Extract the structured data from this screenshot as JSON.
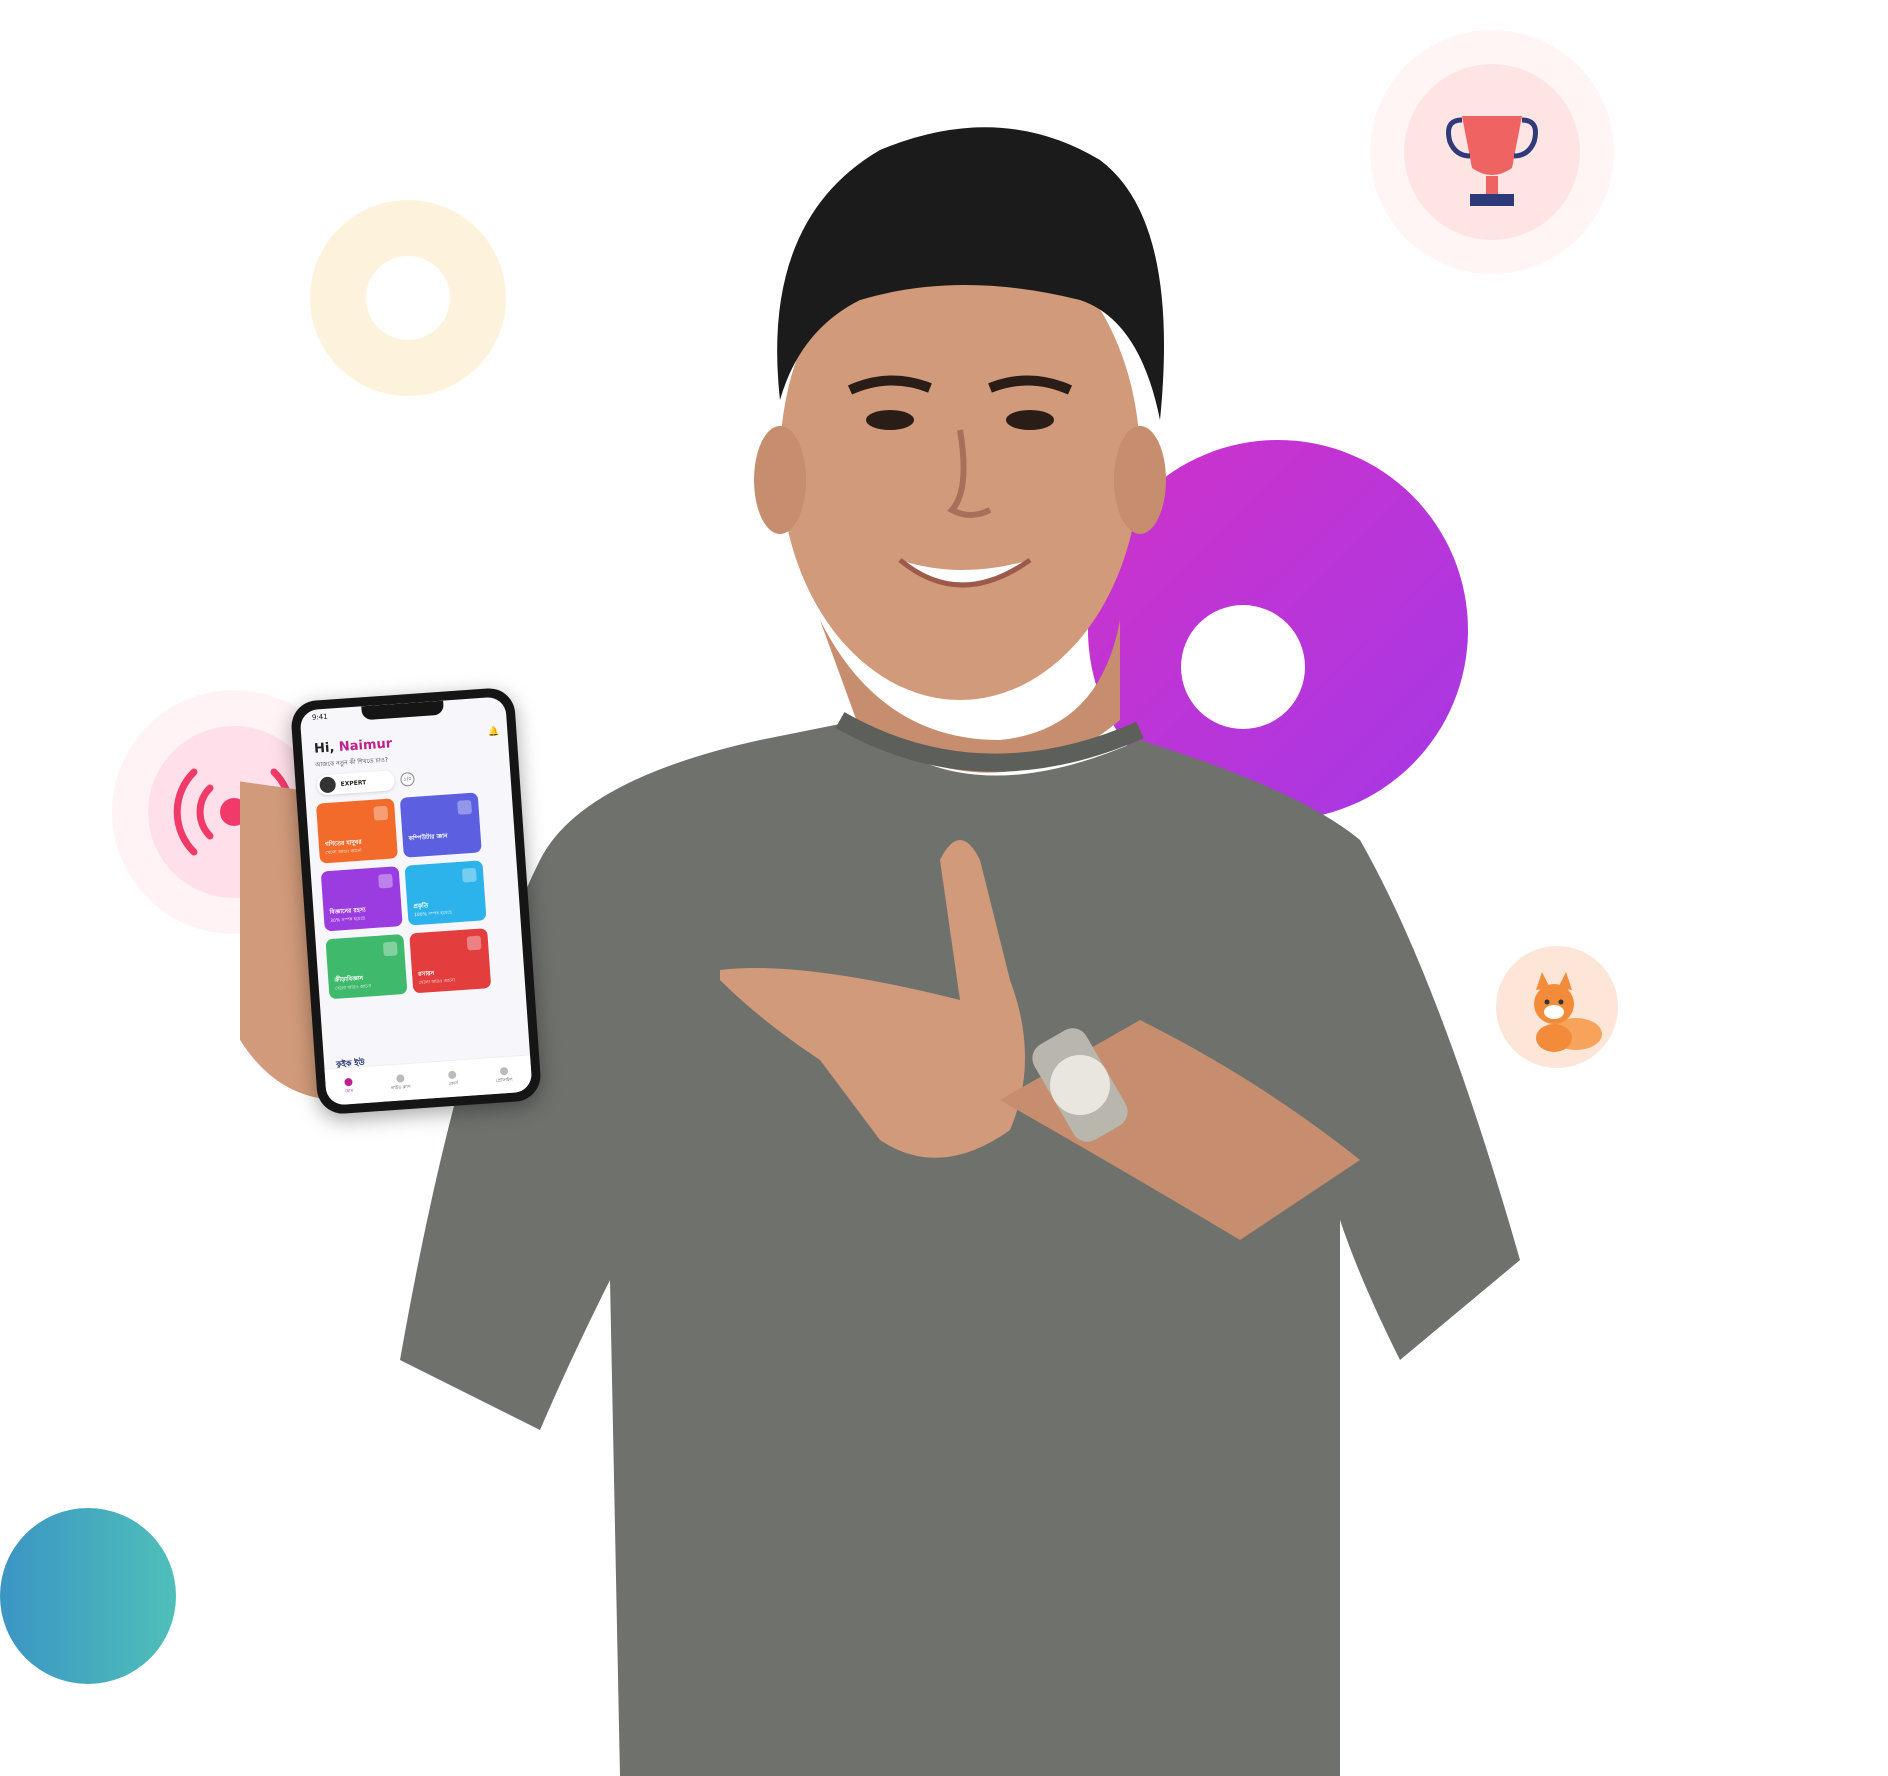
{
  "phone": {
    "status_time": "9:41",
    "greeting_prefix": "Hi,",
    "greeting_name": "Naimur",
    "subtitle": "আজকে নতুন কী শিখতে চাও?",
    "level_label": "EXPERT",
    "level_badge": "১/৫",
    "cards": [
      {
        "title": "গণিতের যাদুঘর",
        "subtitle": "খেলো আরও জানো",
        "color": "#f26b2a"
      },
      {
        "title": "কম্পিউটার জ্ঞান",
        "subtitle": "",
        "color": "#5b5fe0"
      },
      {
        "title": "বিজ্ঞানের রহস্য",
        "subtitle": "30% সম্পন্ন হয়েছে",
        "color": "#9b3ce0"
      },
      {
        "title": "প্রকৃতি",
        "subtitle": "100% সম্পন্ন হয়েছে",
        "color": "#2cb3ec"
      },
      {
        "title": "ক্রীড়াবিজ্ঞান",
        "subtitle": "খেলো আরও জানো",
        "color": "#3fb96b"
      },
      {
        "title": "রসায়ন",
        "subtitle": "খেলো আরও জানো",
        "color": "#e43d3d"
      }
    ],
    "section_title": "কুইক ইউ",
    "nav": [
      {
        "label": "হোম",
        "active": true
      },
      {
        "label": "লাইভ ক্লাস",
        "active": false
      },
      {
        "label": "কোর্স",
        "active": false
      },
      {
        "label": "প্রোফাইল",
        "active": false
      }
    ]
  },
  "icons": {
    "trophy": "trophy-icon",
    "live": "live-broadcast-icon",
    "fox": "fox-mascot-icon"
  },
  "colors": {
    "accent_pink": "#c0208e",
    "purple_ring": "#b838e0",
    "teal_circle": "#45aac0",
    "trophy_red": "#f06363",
    "shirt_gray": "#6f716d"
  }
}
